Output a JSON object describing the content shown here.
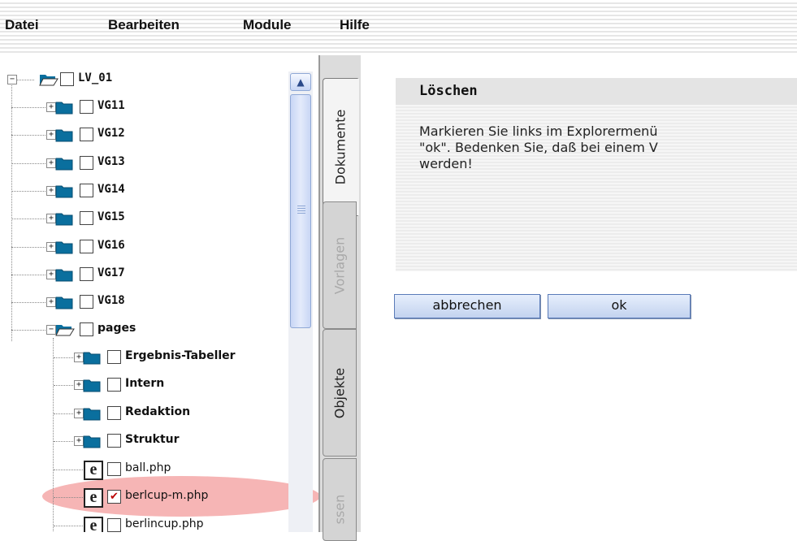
{
  "menubar": {
    "items": [
      "Datei",
      "Bearbeiten",
      "Module",
      "Hilfe"
    ]
  },
  "tree": {
    "root": {
      "label": "LV_01",
      "checked": false
    },
    "groups": [
      {
        "label": "VG11"
      },
      {
        "label": "VG12"
      },
      {
        "label": "VG13"
      },
      {
        "label": "VG14"
      },
      {
        "label": "VG15"
      },
      {
        "label": "VG16"
      },
      {
        "label": "VG17"
      },
      {
        "label": "VG18"
      }
    ],
    "pages": {
      "label": "pages",
      "folders": [
        "Ergebnis-Tabeller",
        "Intern",
        "Redaktion",
        "Struktur"
      ],
      "files": [
        {
          "label": "ball.php",
          "checked": false
        },
        {
          "label": "berlcup-m.php",
          "checked": true
        },
        {
          "label": "berlincup.php",
          "checked": false
        }
      ]
    }
  },
  "tabs": [
    "Dokumente",
    "Vorlagen",
    "Objekte",
    "Klassen"
  ],
  "tabs_visible": [
    "Dokumente",
    "Vorlagen",
    "Objekte",
    "ssen"
  ],
  "active_tab": "Dokumente",
  "dialog": {
    "title": "Löschen",
    "lines": [
      "Markieren Sie links im Explorermenü",
      "\"ok\". Bedenken Sie, daß bei einem V",
      "werden!"
    ]
  },
  "buttons": {
    "cancel_label": "abbrechen",
    "ok_label": "ok"
  },
  "colors": {
    "folder": "#0a6f9e",
    "highlight": "#f4a8a8",
    "button_border": "#5a7bb8"
  }
}
